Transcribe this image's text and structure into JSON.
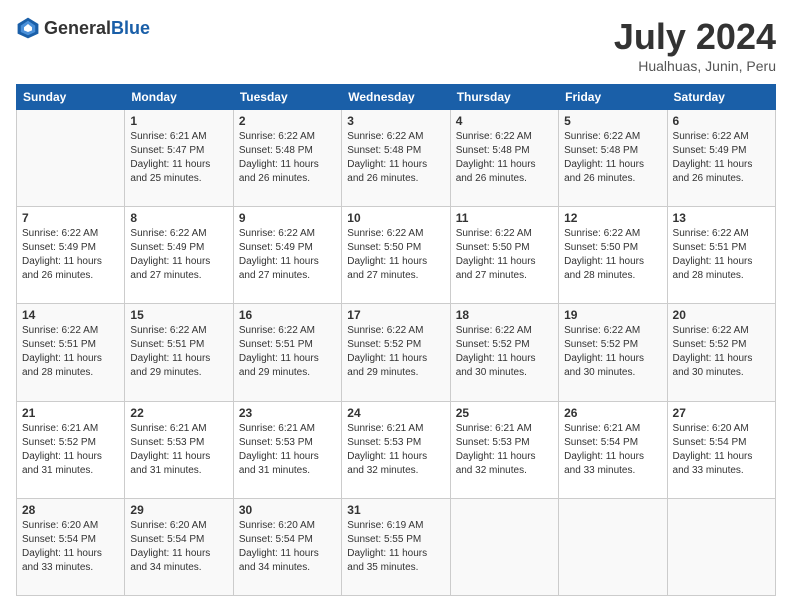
{
  "logo": {
    "general": "General",
    "blue": "Blue"
  },
  "header": {
    "title": "July 2024",
    "subtitle": "Hualhuas, Junin, Peru"
  },
  "calendar": {
    "columns": [
      "Sunday",
      "Monday",
      "Tuesday",
      "Wednesday",
      "Thursday",
      "Friday",
      "Saturday"
    ],
    "weeks": [
      [
        {
          "day": "",
          "sunrise": "",
          "sunset": "",
          "daylight": ""
        },
        {
          "day": "1",
          "sunrise": "Sunrise: 6:21 AM",
          "sunset": "Sunset: 5:47 PM",
          "daylight": "Daylight: 11 hours and 25 minutes."
        },
        {
          "day": "2",
          "sunrise": "Sunrise: 6:22 AM",
          "sunset": "Sunset: 5:48 PM",
          "daylight": "Daylight: 11 hours and 26 minutes."
        },
        {
          "day": "3",
          "sunrise": "Sunrise: 6:22 AM",
          "sunset": "Sunset: 5:48 PM",
          "daylight": "Daylight: 11 hours and 26 minutes."
        },
        {
          "day": "4",
          "sunrise": "Sunrise: 6:22 AM",
          "sunset": "Sunset: 5:48 PM",
          "daylight": "Daylight: 11 hours and 26 minutes."
        },
        {
          "day": "5",
          "sunrise": "Sunrise: 6:22 AM",
          "sunset": "Sunset: 5:48 PM",
          "daylight": "Daylight: 11 hours and 26 minutes."
        },
        {
          "day": "6",
          "sunrise": "Sunrise: 6:22 AM",
          "sunset": "Sunset: 5:49 PM",
          "daylight": "Daylight: 11 hours and 26 minutes."
        }
      ],
      [
        {
          "day": "7",
          "sunrise": "Sunrise: 6:22 AM",
          "sunset": "Sunset: 5:49 PM",
          "daylight": "Daylight: 11 hours and 26 minutes."
        },
        {
          "day": "8",
          "sunrise": "Sunrise: 6:22 AM",
          "sunset": "Sunset: 5:49 PM",
          "daylight": "Daylight: 11 hours and 27 minutes."
        },
        {
          "day": "9",
          "sunrise": "Sunrise: 6:22 AM",
          "sunset": "Sunset: 5:49 PM",
          "daylight": "Daylight: 11 hours and 27 minutes."
        },
        {
          "day": "10",
          "sunrise": "Sunrise: 6:22 AM",
          "sunset": "Sunset: 5:50 PM",
          "daylight": "Daylight: 11 hours and 27 minutes."
        },
        {
          "day": "11",
          "sunrise": "Sunrise: 6:22 AM",
          "sunset": "Sunset: 5:50 PM",
          "daylight": "Daylight: 11 hours and 27 minutes."
        },
        {
          "day": "12",
          "sunrise": "Sunrise: 6:22 AM",
          "sunset": "Sunset: 5:50 PM",
          "daylight": "Daylight: 11 hours and 28 minutes."
        },
        {
          "day": "13",
          "sunrise": "Sunrise: 6:22 AM",
          "sunset": "Sunset: 5:51 PM",
          "daylight": "Daylight: 11 hours and 28 minutes."
        }
      ],
      [
        {
          "day": "14",
          "sunrise": "Sunrise: 6:22 AM",
          "sunset": "Sunset: 5:51 PM",
          "daylight": "Daylight: 11 hours and 28 minutes."
        },
        {
          "day": "15",
          "sunrise": "Sunrise: 6:22 AM",
          "sunset": "Sunset: 5:51 PM",
          "daylight": "Daylight: 11 hours and 29 minutes."
        },
        {
          "day": "16",
          "sunrise": "Sunrise: 6:22 AM",
          "sunset": "Sunset: 5:51 PM",
          "daylight": "Daylight: 11 hours and 29 minutes."
        },
        {
          "day": "17",
          "sunrise": "Sunrise: 6:22 AM",
          "sunset": "Sunset: 5:52 PM",
          "daylight": "Daylight: 11 hours and 29 minutes."
        },
        {
          "day": "18",
          "sunrise": "Sunrise: 6:22 AM",
          "sunset": "Sunset: 5:52 PM",
          "daylight": "Daylight: 11 hours and 30 minutes."
        },
        {
          "day": "19",
          "sunrise": "Sunrise: 6:22 AM",
          "sunset": "Sunset: 5:52 PM",
          "daylight": "Daylight: 11 hours and 30 minutes."
        },
        {
          "day": "20",
          "sunrise": "Sunrise: 6:22 AM",
          "sunset": "Sunset: 5:52 PM",
          "daylight": "Daylight: 11 hours and 30 minutes."
        }
      ],
      [
        {
          "day": "21",
          "sunrise": "Sunrise: 6:21 AM",
          "sunset": "Sunset: 5:52 PM",
          "daylight": "Daylight: 11 hours and 31 minutes."
        },
        {
          "day": "22",
          "sunrise": "Sunrise: 6:21 AM",
          "sunset": "Sunset: 5:53 PM",
          "daylight": "Daylight: 11 hours and 31 minutes."
        },
        {
          "day": "23",
          "sunrise": "Sunrise: 6:21 AM",
          "sunset": "Sunset: 5:53 PM",
          "daylight": "Daylight: 11 hours and 31 minutes."
        },
        {
          "day": "24",
          "sunrise": "Sunrise: 6:21 AM",
          "sunset": "Sunset: 5:53 PM",
          "daylight": "Daylight: 11 hours and 32 minutes."
        },
        {
          "day": "25",
          "sunrise": "Sunrise: 6:21 AM",
          "sunset": "Sunset: 5:53 PM",
          "daylight": "Daylight: 11 hours and 32 minutes."
        },
        {
          "day": "26",
          "sunrise": "Sunrise: 6:21 AM",
          "sunset": "Sunset: 5:54 PM",
          "daylight": "Daylight: 11 hours and 33 minutes."
        },
        {
          "day": "27",
          "sunrise": "Sunrise: 6:20 AM",
          "sunset": "Sunset: 5:54 PM",
          "daylight": "Daylight: 11 hours and 33 minutes."
        }
      ],
      [
        {
          "day": "28",
          "sunrise": "Sunrise: 6:20 AM",
          "sunset": "Sunset: 5:54 PM",
          "daylight": "Daylight: 11 hours and 33 minutes."
        },
        {
          "day": "29",
          "sunrise": "Sunrise: 6:20 AM",
          "sunset": "Sunset: 5:54 PM",
          "daylight": "Daylight: 11 hours and 34 minutes."
        },
        {
          "day": "30",
          "sunrise": "Sunrise: 6:20 AM",
          "sunset": "Sunset: 5:54 PM",
          "daylight": "Daylight: 11 hours and 34 minutes."
        },
        {
          "day": "31",
          "sunrise": "Sunrise: 6:19 AM",
          "sunset": "Sunset: 5:55 PM",
          "daylight": "Daylight: 11 hours and 35 minutes."
        },
        {
          "day": "",
          "sunrise": "",
          "sunset": "",
          "daylight": ""
        },
        {
          "day": "",
          "sunrise": "",
          "sunset": "",
          "daylight": ""
        },
        {
          "day": "",
          "sunrise": "",
          "sunset": "",
          "daylight": ""
        }
      ]
    ]
  }
}
